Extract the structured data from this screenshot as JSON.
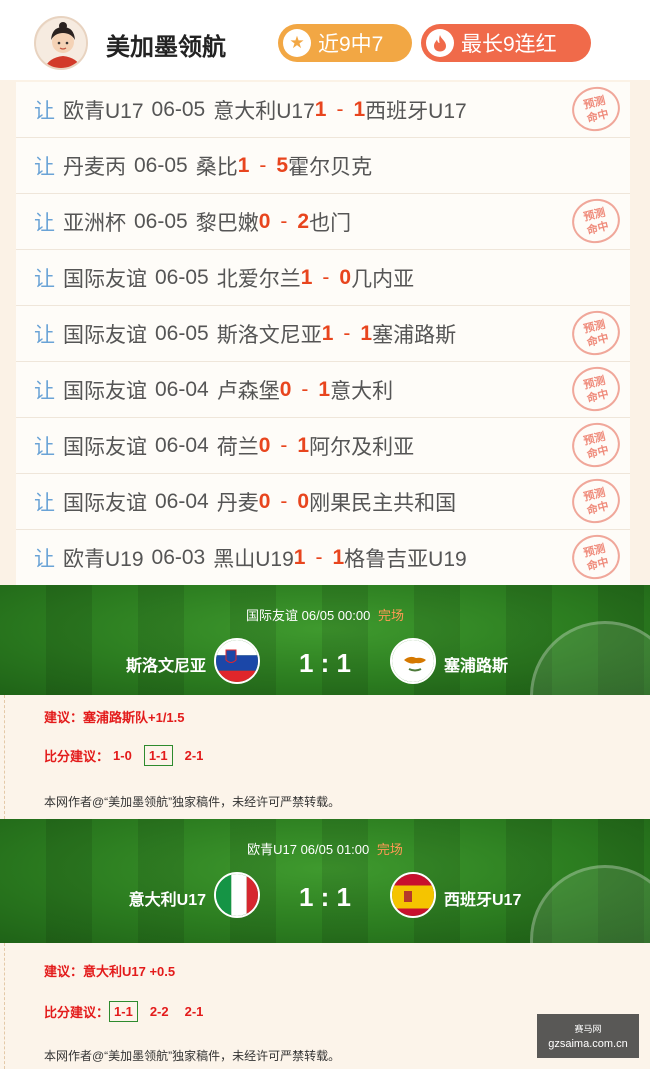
{
  "header": {
    "expert_name": "美加墨领航",
    "streak_badge": "近9中7",
    "longest_badge": "最长9连红"
  },
  "records": [
    {
      "tag": "让",
      "league": "欧青U17",
      "date": "06-05",
      "home": "意大利U17",
      "home_score": "1",
      "away_score": "1",
      "away": "西班牙U17",
      "hit": true
    },
    {
      "tag": "让",
      "league": "丹麦丙",
      "date": "06-05",
      "home": "桑比",
      "home_score": "1",
      "away_score": "5",
      "away": "霍尔贝克",
      "hit": false
    },
    {
      "tag": "让",
      "league": "亚洲杯",
      "date": "06-05",
      "home": "黎巴嫩",
      "home_score": "0",
      "away_score": "2",
      "away": "也门",
      "hit": true
    },
    {
      "tag": "让",
      "league": "国际友谊",
      "date": "06-05",
      "home": "北爱尔兰",
      "home_score": "1",
      "away_score": "0",
      "away": "几内亚",
      "hit": false
    },
    {
      "tag": "让",
      "league": "国际友谊",
      "date": "06-05",
      "home": "斯洛文尼亚",
      "home_score": "1",
      "away_score": "1",
      "away": "塞浦路斯",
      "hit": true
    },
    {
      "tag": "让",
      "league": "国际友谊",
      "date": "06-04",
      "home": "卢森堡",
      "home_score": "0",
      "away_score": "1",
      "away": "意大利",
      "hit": true
    },
    {
      "tag": "让",
      "league": "国际友谊",
      "date": "06-04",
      "home": "荷兰",
      "home_score": "0",
      "away_score": "1",
      "away": "阿尔及利亚",
      "hit": true
    },
    {
      "tag": "让",
      "league": "国际友谊",
      "date": "06-04",
      "home": "丹麦",
      "home_score": "0",
      "away_score": "0",
      "away": "刚果民主共和国",
      "hit": true
    },
    {
      "tag": "让",
      "league": "欧青U19",
      "date": "06-03",
      "home": "黑山U19",
      "home_score": "1",
      "away_score": "1",
      "away": "格鲁吉亚U19",
      "hit": true
    }
  ],
  "hit_stamp": [
    "预测",
    "命中"
  ],
  "matches": [
    {
      "info": "国际友谊 06/05 00:00",
      "status": "完场",
      "home": "斯洛文尼亚",
      "away": "塞浦路斯",
      "score": "1 : 1",
      "home_flag": "slovenia-flag",
      "away_flag": "cyprus-flag",
      "suggestion": "建议：塞浦路斯队+1/1.5",
      "score_label": "比分建议：",
      "score_options": [
        "1-0",
        "1-1",
        "2-1"
      ],
      "selected_option": 1,
      "copyright": "本网作者@“美加墨领航”独家稿件，未经许可严禁转载。"
    },
    {
      "info": "欧青U17 06/05 01:00",
      "status": "完场",
      "home": "意大利U17",
      "away": "西班牙U17",
      "score": "1 : 1",
      "home_flag": "italy-flag",
      "away_flag": "spain-flag",
      "suggestion": "建议：意大利U17  +0.5",
      "score_label": "比分建议：",
      "score_options": [
        "1-1",
        "2-2",
        "2-1"
      ],
      "selected_option": 0,
      "copyright": "本网作者@“美加墨领航”独家稿件，未经许可严禁转载。"
    }
  ],
  "watermark": {
    "line1": "赛马网",
    "line2": "gzsaima.com.cn"
  },
  "colors": {
    "accent_red": "#e8451e",
    "streak": "#f2a744",
    "longest": "#f06a4a",
    "pitch": "#2c7d20"
  }
}
